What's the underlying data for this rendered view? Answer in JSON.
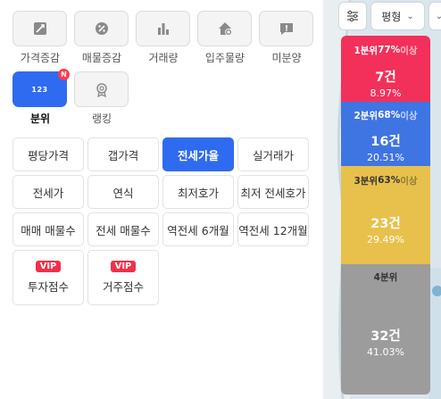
{
  "icon_buttons": [
    {
      "label": "가격증감",
      "icon": "price-change-icon"
    },
    {
      "label": "매물증감",
      "icon": "listing-change-icon"
    },
    {
      "label": "거래량",
      "icon": "bar-chart-icon"
    },
    {
      "label": "입주물량",
      "icon": "house-plus-icon"
    },
    {
      "label": "미분양",
      "icon": "alert-message-icon"
    },
    {
      "label": "분위",
      "icon": "number-123-icon",
      "badge": "N",
      "glyph": "123"
    },
    {
      "label": "랭킹",
      "icon": "medal-icon"
    }
  ],
  "options": [
    [
      "평당가격",
      "갭가격",
      "전세가율",
      "실거래가"
    ],
    [
      "전세가",
      "연식",
      "최저호가",
      "최저 전세호가"
    ],
    [
      "매매 매물수",
      "전세 매물수",
      "역전세 6개월",
      "역전세 12개월"
    ]
  ],
  "selected_option": "전세가율",
  "vip_cards": [
    {
      "badge": "VIP",
      "label": "투자점수"
    },
    {
      "badge": "VIP",
      "label": "거주점수"
    }
  ],
  "map_controls": {
    "filter_icon": "sliders-icon",
    "area_label": "평형",
    "area_chevron": "chevron-down-icon"
  },
  "legend": {
    "q1": {
      "header_prefix": "1분위 ",
      "header_value": "77%",
      "header_suffix": "이상",
      "count": "7건",
      "percent": "8.97%"
    },
    "q2": {
      "header_prefix": "2분위 ",
      "header_value": "68%",
      "header_suffix": "이상",
      "count": "16건",
      "percent": "20.51%"
    },
    "q3": {
      "header_prefix": "3분위 ",
      "header_value": "63%",
      "header_suffix": "이상",
      "count": "23건",
      "percent": "29.49%"
    },
    "q4": {
      "header_prefix": "4분위",
      "header_value": "",
      "header_suffix": "",
      "count": "32건",
      "percent": "41.03%"
    }
  },
  "colors": {
    "accent": "#2f6bf0",
    "q1": "#f2305a",
    "q2": "#3f74e3",
    "q3": "#e8c04c",
    "q4": "#9c9c9c"
  }
}
